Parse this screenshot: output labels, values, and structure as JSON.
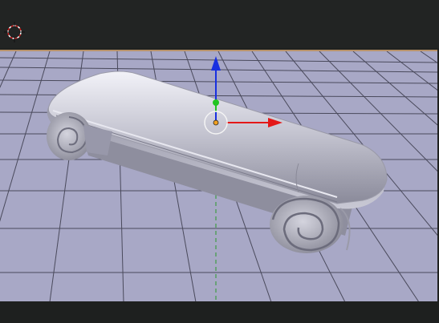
{
  "viewport": {
    "background": "#a8a8c6",
    "grid_color": "#4a4a5c",
    "frame_color": "#b8926a"
  },
  "object": {
    "shape": "scroll-bench",
    "material_color": "#c4c4d0"
  },
  "gizmo": {
    "x_axis_color": "#e41818",
    "y_axis_color": "#1830e0",
    "z_axis_color": "#22c422",
    "icons": [
      "cursor-3d-icon",
      "transform-gizmo-icon",
      "origin-point-icon"
    ]
  }
}
